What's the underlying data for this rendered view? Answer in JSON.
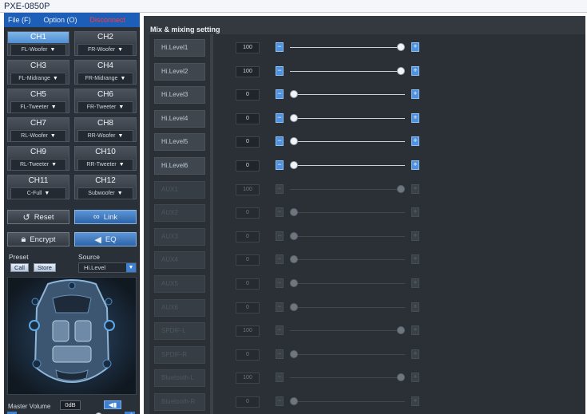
{
  "window": {
    "title": "PXE-0850P"
  },
  "menu": {
    "file": "File (F)",
    "option": "Option (O)",
    "disconnect": "Disconnect"
  },
  "channels": [
    {
      "name": "CH1",
      "sel": "FL-Woofer",
      "active": true
    },
    {
      "name": "CH2",
      "sel": "FR-Woofer"
    },
    {
      "name": "CH3",
      "sel": "FL-Midrange"
    },
    {
      "name": "CH4",
      "sel": "FR-Midrange"
    },
    {
      "name": "CH5",
      "sel": "FL-Tweeter"
    },
    {
      "name": "CH6",
      "sel": "FR-Tweeter"
    },
    {
      "name": "CH7",
      "sel": "RL-Woofer"
    },
    {
      "name": "CH8",
      "sel": "RR-Woofer"
    },
    {
      "name": "CH9",
      "sel": "RL-Tweeter"
    },
    {
      "name": "CH10",
      "sel": "RR-Tweeter"
    },
    {
      "name": "CH11",
      "sel": "C-Full"
    },
    {
      "name": "CH12",
      "sel": "Subwoofer"
    }
  ],
  "buttons": {
    "reset": "Reset",
    "link": "Link",
    "encrypt": "Encrypt",
    "eq": "EQ"
  },
  "preset": {
    "label": "Preset",
    "call": "Call",
    "store": "Store"
  },
  "source": {
    "label": "Source",
    "value": "Hi.Level"
  },
  "master": {
    "label": "Master Volume",
    "value": "0dB",
    "level": 0.85
  },
  "mix": {
    "title": "Mix & mixing setting",
    "rows": [
      {
        "label": "Hi.Level1",
        "value": "100",
        "level": 1.0,
        "enabled": true
      },
      {
        "label": "Hi.Level2",
        "value": "100",
        "level": 1.0,
        "enabled": true
      },
      {
        "label": "Hi.Level3",
        "value": "0",
        "level": 0.0,
        "enabled": true
      },
      {
        "label": "Hi.Level4",
        "value": "0",
        "level": 0.0,
        "enabled": true
      },
      {
        "label": "Hi.Level5",
        "value": "0",
        "level": 0.0,
        "enabled": true
      },
      {
        "label": "Hi.Level6",
        "value": "0",
        "level": 0.0,
        "enabled": true
      },
      {
        "label": "AUX1",
        "value": "100",
        "level": 1.0,
        "enabled": false
      },
      {
        "label": "AUX2",
        "value": "0",
        "level": 0.0,
        "enabled": false
      },
      {
        "label": "AUX3",
        "value": "0",
        "level": 0.0,
        "enabled": false
      },
      {
        "label": "AUX4",
        "value": "0",
        "level": 0.0,
        "enabled": false
      },
      {
        "label": "AUX5",
        "value": "0",
        "level": 0.0,
        "enabled": false
      },
      {
        "label": "AUX6",
        "value": "0",
        "level": 0.0,
        "enabled": false
      },
      {
        "label": "SPDIF-L",
        "value": "100",
        "level": 1.0,
        "enabled": false
      },
      {
        "label": "SPDIF-R",
        "value": "0",
        "level": 0.0,
        "enabled": false
      },
      {
        "label": "Bluetooth-L",
        "value": "100",
        "level": 1.0,
        "enabled": false
      },
      {
        "label": "Bluetooth-R",
        "value": "0",
        "level": 0.0,
        "enabled": false
      }
    ]
  },
  "colors": {
    "accent": "#3d7fd1",
    "disconnect": "#ff3b3b",
    "panel": "#2a3038"
  }
}
